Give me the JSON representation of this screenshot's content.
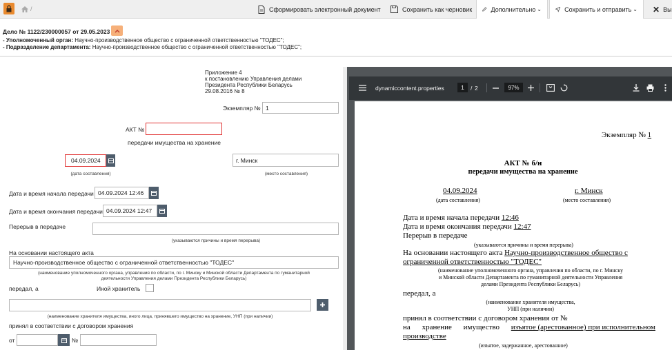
{
  "toolbar": {
    "home_sep": "/",
    "generate_doc": "Сформировать электронный документ",
    "save_draft": "Сохранить как черновик",
    "more": "Дополнительно",
    "save_send": "Сохранить и отправить",
    "exit": "Вы"
  },
  "case": {
    "title": "Дело № 1122/230000057 от 29.05.2023",
    "authority_label": "- Уполномоченный орган:",
    "authority_value": "Научно-производственное общество с ограниченной ответственностью \"ТОДЕС\";",
    "dept_label": "- Подразделение департамента:",
    "dept_value": "Научно-производственное общество с ограниченной ответственностью \"ТОДЕС\";"
  },
  "form": {
    "annex_line1": "Приложение 4",
    "annex_line2": "к постановлению Управления делами",
    "annex_line3": "Президента Республики Беларусь",
    "annex_line4": "29.08.2016 № 8",
    "copy_label": "Экземпляр №",
    "copy_value": "1",
    "act_label": "АКТ №",
    "act_value": "",
    "act_subtitle": "передачи имущества на хранение",
    "date_value": "04.09.2024",
    "date_note": "(дата составления)",
    "place_value": "г. Минск",
    "place_note": "(место составления)",
    "start_label": "Дата и время начала передачи",
    "start_value": "04.09.2024 12:46",
    "end_label": "Дата и время окончания передачи",
    "end_value": "04.09.2024 12:47",
    "break_label": "Перерыв в передаче",
    "break_value": "",
    "break_note": "(указываются причины и время перерыва)",
    "basis_label": "На основании настоящего акта",
    "basis_value": "Научно-производственное общество с ограниченной ответственностью \"ТОДЕС\"",
    "basis_note1": "(наименование уполномоченного органа, управления по области, по г. Минску и Минской области Департамента по гуманитарной",
    "basis_note2": "деятельности Управления делами Президента Республики Беларусь)",
    "transferred_label": "передал, а",
    "other_keeper_label": "Иной хранитель",
    "other_keeper_checked": false,
    "keeper_value": "",
    "keeper_note": "(наименование хранителя имущества, иного лица, принявшего имущество на хранение, УНП (при наличии)",
    "accepted_label": "принял в соответствии с договором хранения",
    "from_label": "от",
    "from_value": "",
    "num_label": "№",
    "num_value": ""
  },
  "pdf": {
    "filename": "dynamiccontent.properties",
    "page_current": "1",
    "page_sep": "/",
    "page_total": "2",
    "zoom": "97%",
    "copy_line": "Экземпляр №",
    "copy_num": "1",
    "title1": "АКТ № б/н",
    "title2": "передачи имущества на хранение",
    "date": "04.09.2024",
    "date_note": "(дата составления)",
    "place": "г. Минск",
    "place_note": "(место составления)",
    "start_prefix": "Дата и время начала передачи",
    "start_time": "12:46",
    "end_prefix": "Дата и время окончания передачи",
    "end_time": "12:47",
    "break": "Перерыв в передаче",
    "break_note": "(указываются причины и время перерыва)",
    "basis_prefix": "На основании настоящего акта",
    "basis_org1": "Научно-производственное общество с",
    "basis_org2": "ограниченной ответственностью \"ТОДЕС\"",
    "basis_note1": "(наименование уполномоченного органа, управления по области, по г. Минску",
    "basis_note2": "и Минской области Департамента по гуманитарной деятельности Управления",
    "basis_note3": "делами Президента Республики Беларусь)",
    "transferred": "передал, а",
    "keeper_note1": "(наименование хранителя имущества,",
    "keeper_note2": "УНП (при наличии)",
    "accepted": "принял в соответствии с договором хранения от  №",
    "storage_w1": "на",
    "storage_w2": "хранение",
    "storage_w3": "имущество",
    "storage_seized": "изъятое (арестованное) при исполнительном",
    "storage_line2": "производстве",
    "storage_note": "(изъятое, задержанное, арестованное)"
  },
  "colors": {
    "accent": "#e98a2f",
    "accent_light": "#f6b07a",
    "calendar_btn": "#4e5d6c",
    "error_border": "#e03030",
    "pdf_toolbar": "#323639",
    "pdf_bg": "#525659"
  }
}
